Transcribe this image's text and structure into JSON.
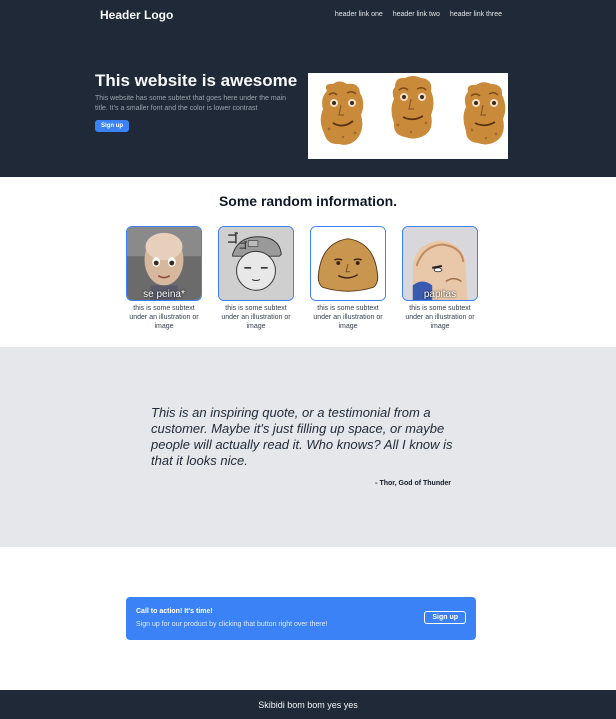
{
  "header": {
    "logo": "Header Logo",
    "links": [
      "header link one",
      "header link two",
      "header link three"
    ]
  },
  "hero": {
    "title": "This website is awesome",
    "subtext": "This website has some subtext that goes here under the main title. It's a smaller font and the color is lower contrast",
    "button_label": "Sign up",
    "image_icon": "chicken-nugget-faces"
  },
  "info": {
    "title": "Some random information.",
    "cards": [
      {
        "overlay": "se peina*",
        "icon": "bald-boy-face",
        "text": "this is some subtext under an illustration or image"
      },
      {
        "overlay": "",
        "icon": "sketched-cap-face",
        "text": "this is some subtext under an illustration or image"
      },
      {
        "overlay": "",
        "icon": "pou-face",
        "text": "this is some subtext under an illustration or image"
      },
      {
        "overlay": "papitas",
        "icon": "anime-character-face",
        "text": "this is some subtext under an illustration or image"
      }
    ]
  },
  "quote": {
    "text": "This is an inspiring quote, or a testimonial from a customer. Maybe it's just filling up space, or maybe people will actually read it. Who knows? All I know is that it looks nice.",
    "author": "- Thor, God of Thunder"
  },
  "cta": {
    "title": "Call to action! It's time!",
    "subtext": "Sign up for our product by clicking that button right over there!",
    "button_label": "Sign up"
  },
  "footer": {
    "text": "Skibidi bom bom yes yes"
  },
  "colors": {
    "dark": "#1f2937",
    "accent": "#3b82f6",
    "quote_bg": "#e5e7eb"
  }
}
